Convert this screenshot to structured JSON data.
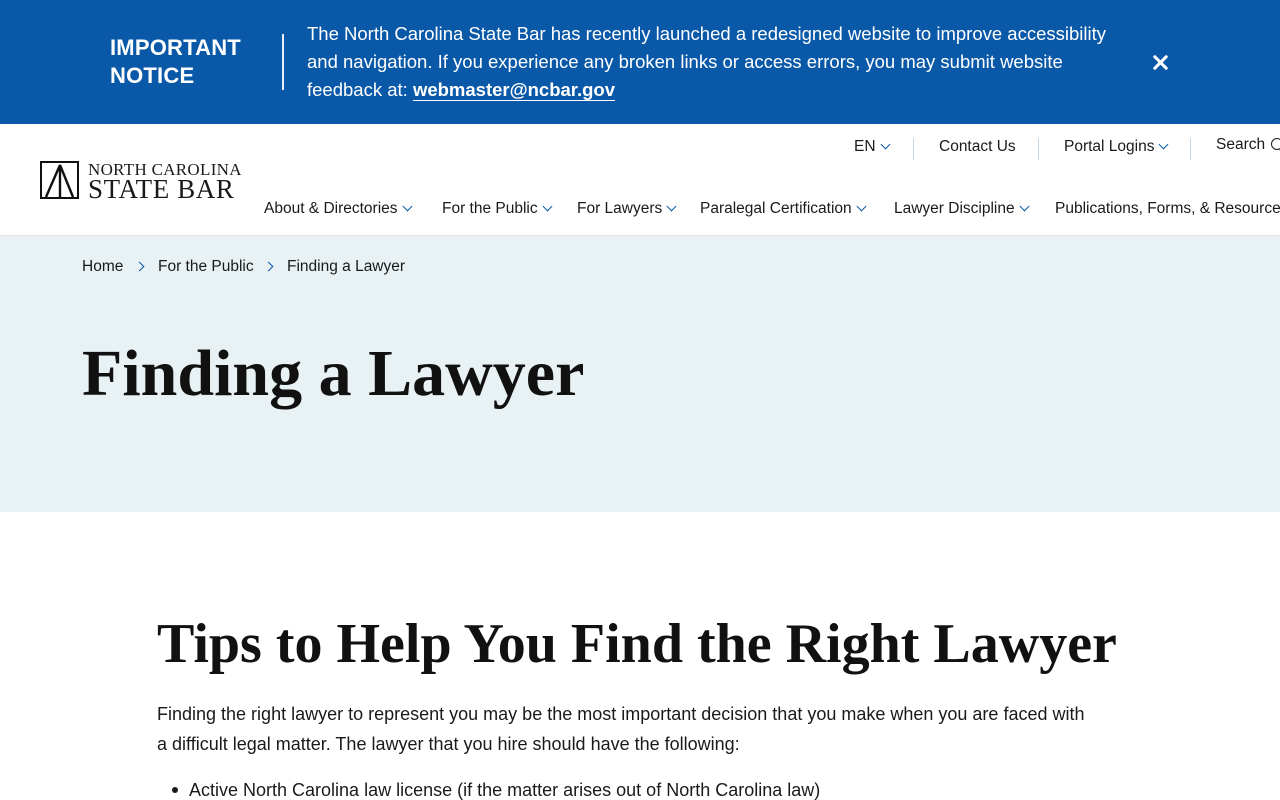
{
  "notice": {
    "title": "IMPORTANT NOTICE",
    "text": "The North Carolina State Bar has recently launched a redesigned website to improve accessibility and navigation. If you experience any broken links or access errors, you may submit website feedback at: ",
    "email": "webmaster@ncbar.gov",
    "close_icon": "close-icon",
    "bg_color": "#0a59a8"
  },
  "logo": {
    "line1": "NORTH CAROLINA",
    "line2": "STATE BAR"
  },
  "utility": {
    "language": "EN",
    "contact": "Contact Us",
    "portal": "Portal Logins",
    "search": "Search"
  },
  "nav": {
    "items": [
      "About & Directories",
      "For the Public",
      "For Lawyers",
      "Paralegal Certification",
      "Lawyer Discipline",
      "Publications, Forms, & Resources"
    ]
  },
  "breadcrumb": [
    "Home",
    "For the Public",
    "Finding a Lawyer"
  ],
  "hero": {
    "title": "Finding a Lawyer",
    "bg_color": "#e8f1f4"
  },
  "content": {
    "heading": "Tips to Help You Find the Right Lawyer",
    "intro": "Finding the right lawyer to represent you may be the most important decision that you make when you are faced with a difficult legal matter. The lawyer that you hire should have the following:",
    "bullets": [
      "Active North Carolina law license (if the matter arises out of North Carolina law)"
    ]
  }
}
